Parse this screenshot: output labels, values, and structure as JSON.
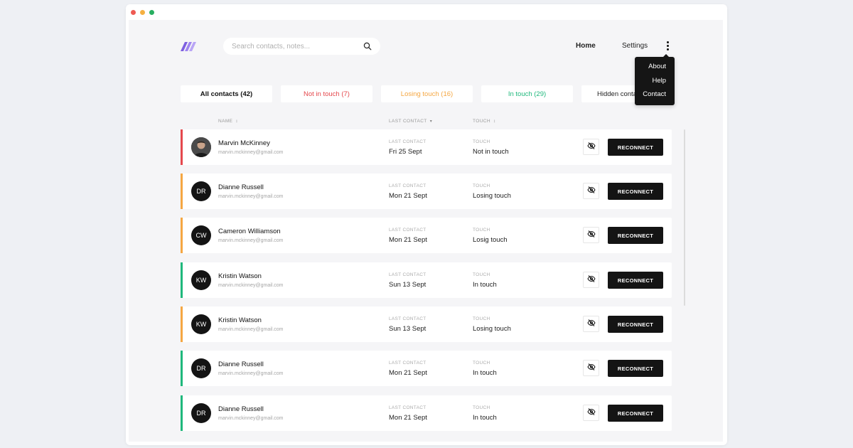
{
  "search": {
    "placeholder": "Search contacts, notes..."
  },
  "nav": {
    "home": "Home",
    "settings": "Settings"
  },
  "menu": [
    "About",
    "Help",
    "Contact"
  ],
  "tabs": [
    {
      "label": "All contacts (42)"
    },
    {
      "label": "Not in touch (7)"
    },
    {
      "label": "Losing touch (16)"
    },
    {
      "label": "In touch (29)"
    },
    {
      "label": "Hidden contacts"
    }
  ],
  "columns": {
    "name": "NAME",
    "last_contact": "LAST CONTACT",
    "touch": "TOUCH"
  },
  "row_labels": {
    "last_contact": "LAST CONTACT",
    "touch": "TOUCH",
    "button": "RECONNECT"
  },
  "colors": {
    "red": "#e5484d",
    "orange": "#f5a742",
    "green": "#1fb87c"
  },
  "contacts": [
    {
      "initials": "",
      "photo": true,
      "name": "Marvin McKinney",
      "email": "marvin.mckinney@gmail.com",
      "last_contact": "Fri 25 Sept",
      "touch": "Not in touch",
      "status": "red"
    },
    {
      "initials": "DR",
      "name": "Dianne Russell",
      "email": "marvin.mckinney@gmail.com",
      "last_contact": "Mon 21 Sept",
      "touch": "Losing touch",
      "status": "orange"
    },
    {
      "initials": "CW",
      "name": "Cameron Williamson",
      "email": "marvin.mckinney@gmail.com",
      "last_contact": "Mon 21 Sept",
      "touch": "Losig touch",
      "status": "orange"
    },
    {
      "initials": "KW",
      "name": "Kristin Watson",
      "email": "marvin.mckinney@gmail.com",
      "last_contact": "Sun 13 Sept",
      "touch": "In touch",
      "status": "green"
    },
    {
      "initials": "KW",
      "name": "Kristin Watson",
      "email": "marvin.mckinney@gmail.com",
      "last_contact": "Sun 13 Sept",
      "touch": "Losing touch",
      "status": "orange"
    },
    {
      "initials": "DR",
      "name": "Dianne Russell",
      "email": "marvin.mckinney@gmail.com",
      "last_contact": "Mon 21 Sept",
      "touch": "In touch",
      "status": "green"
    },
    {
      "initials": "DR",
      "name": "Dianne Russell",
      "email": "marvin.mckinney@gmail.com",
      "last_contact": "Mon 21 Sept",
      "touch": "In touch",
      "status": "green"
    }
  ]
}
